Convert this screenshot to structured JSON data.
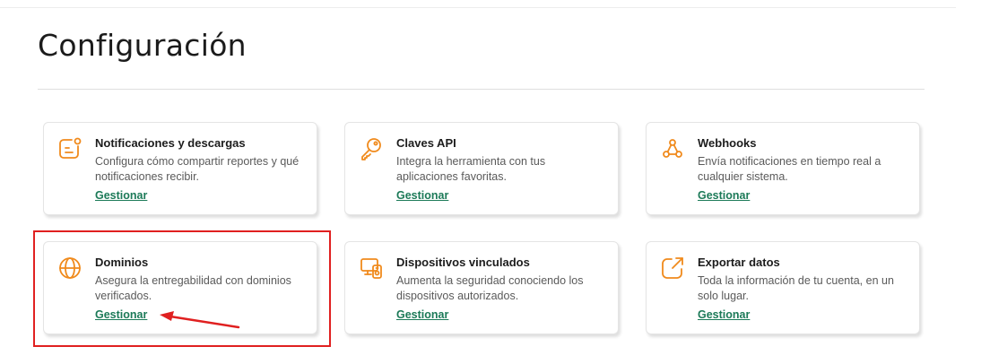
{
  "page": {
    "title": "Configuración"
  },
  "cards": [
    {
      "title": "Notificaciones y descargas",
      "description": "Configura cómo compartir reportes y qué notificaciones recibir.",
      "link": "Gestionar",
      "icon": "notification-icon"
    },
    {
      "title": "Claves API",
      "description": "Integra la herramienta con tus aplicaciones favoritas.",
      "link": "Gestionar",
      "icon": "key-icon"
    },
    {
      "title": "Webhooks",
      "description": "Envía notificaciones en tiempo real a cualquier sistema.",
      "link": "Gestionar",
      "icon": "webhook-icon"
    },
    {
      "title": "Dominios",
      "description": "Asegura la entregabilidad con dominios verificados.",
      "link": "Gestionar",
      "icon": "globe-icon"
    },
    {
      "title": "Dispositivos vinculados",
      "description": "Aumenta la seguridad conociendo los dispositivos autorizados.",
      "link": "Gestionar",
      "icon": "devices-icon"
    },
    {
      "title": "Exportar datos",
      "description": "Toda la información de tu cuenta, en un solo lugar.",
      "link": "Gestionar",
      "icon": "export-icon"
    }
  ],
  "colors": {
    "icon": "#f08a1c",
    "link": "#1c7a58",
    "annotation": "#e02020"
  }
}
